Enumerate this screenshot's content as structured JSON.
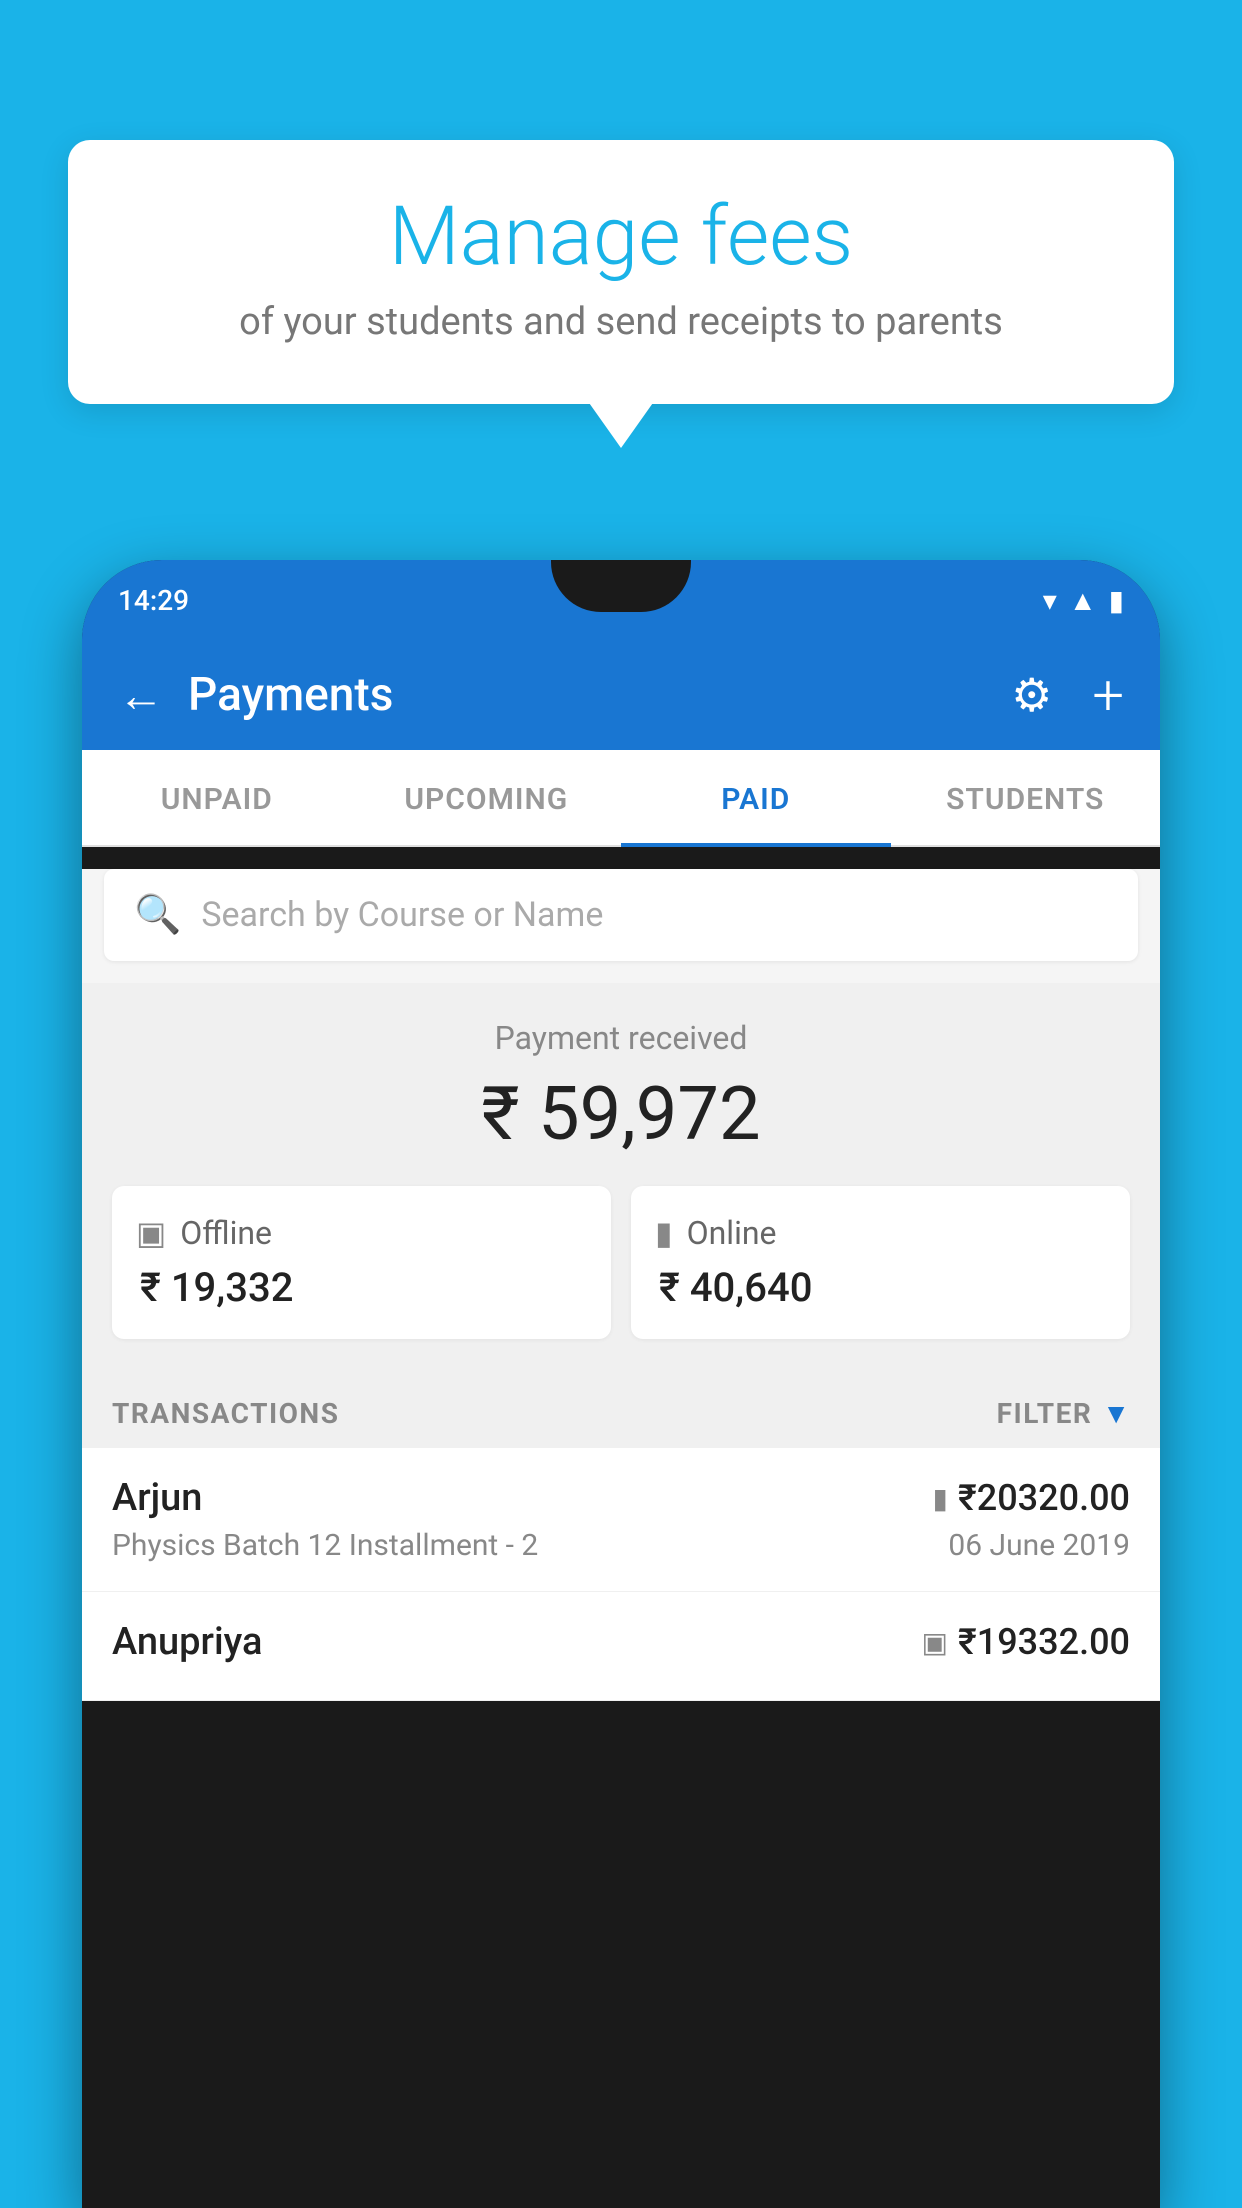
{
  "background_color": "#1ab3e8",
  "bubble": {
    "title": "Manage fees",
    "subtitle": "of your students and send receipts to parents"
  },
  "phone": {
    "status_bar": {
      "time": "14:29"
    },
    "header": {
      "title": "Payments",
      "back_label": "←",
      "plus_label": "+"
    },
    "tabs": [
      {
        "label": "UNPAID",
        "active": false
      },
      {
        "label": "UPCOMING",
        "active": false
      },
      {
        "label": "PAID",
        "active": true
      },
      {
        "label": "STUDENTS",
        "active": false
      }
    ],
    "search": {
      "placeholder": "Search by Course or Name"
    },
    "payment_summary": {
      "label": "Payment received",
      "total": "₹ 59,972",
      "offline_label": "Offline",
      "offline_amount": "₹ 19,332",
      "online_label": "Online",
      "online_amount": "₹ 40,640"
    },
    "transactions_label": "TRANSACTIONS",
    "filter_label": "FILTER",
    "transactions": [
      {
        "name": "Arjun",
        "course": "Physics Batch 12 Installment - 2",
        "amount": "₹20320.00",
        "date": "06 June 2019",
        "payment_type": "online"
      },
      {
        "name": "Anupriya",
        "course": "",
        "amount": "₹19332.00",
        "date": "",
        "payment_type": "offline"
      }
    ]
  }
}
